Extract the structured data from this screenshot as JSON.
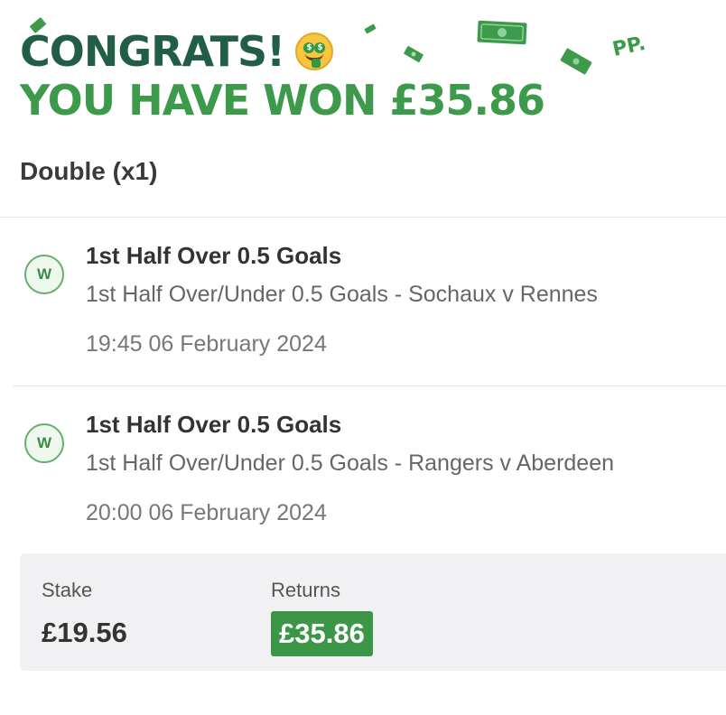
{
  "header": {
    "line1": "CONGRATS!",
    "line1_emoji": "money-mouth-face-icon",
    "line2": "YOU HAVE WON £35.86",
    "brand_mark": "PP."
  },
  "bet": {
    "type_label": "Double (x1)",
    "legs": [
      {
        "result_badge": "W",
        "selection": "1st Half Over 0.5 Goals",
        "market": "1st Half Over/Under 0.5 Goals - Sochaux v Rennes",
        "time": "19:45 06 February 2024"
      },
      {
        "result_badge": "W",
        "selection": "1st Half Over 0.5 Goals",
        "market": "1st Half Over/Under 0.5 Goals - Rangers v Aberdeen",
        "time": "20:00 06 February 2024"
      }
    ]
  },
  "summary": {
    "stake_label": "Stake",
    "stake_value": "£19.56",
    "returns_label": "Returns",
    "returns_value": "£35.86"
  },
  "colors": {
    "headline_dark_green": "#225e45",
    "headline_green": "#3d9a4a",
    "win_green": "#62b06b",
    "returns_bg": "#3c9648",
    "summary_bg": "#f1f1f4"
  }
}
